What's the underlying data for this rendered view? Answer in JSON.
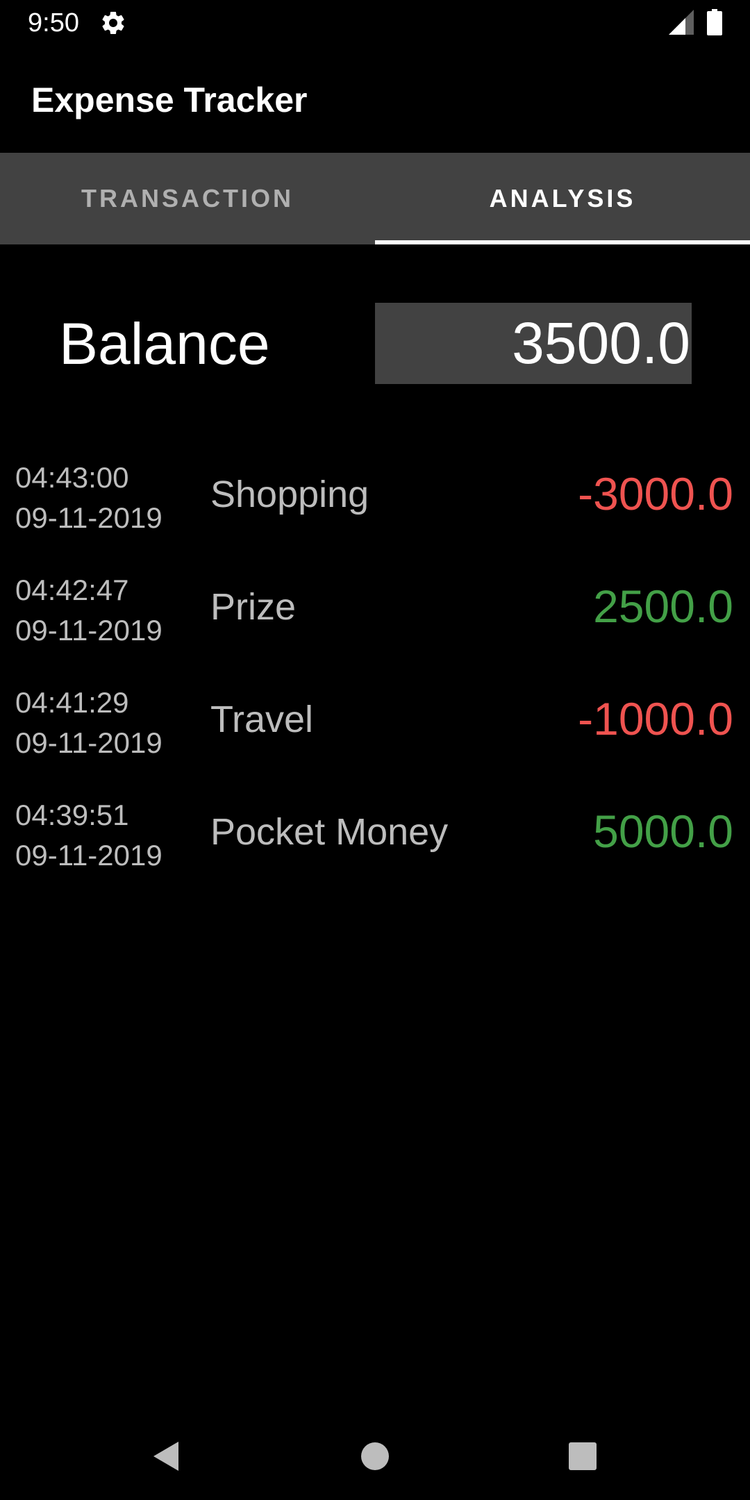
{
  "status_bar": {
    "time": "9:50",
    "icons": [
      "gear-icon",
      "signal-icon",
      "battery-icon"
    ]
  },
  "app": {
    "title": "Expense Tracker"
  },
  "tabs": [
    {
      "label": "TRANSACTION",
      "selected": false
    },
    {
      "label": "ANALYSIS",
      "selected": true
    }
  ],
  "balance": {
    "label": "Balance",
    "value": "3500.0"
  },
  "transactions": [
    {
      "time": "04:43:00",
      "date": "09-11-2019",
      "category": "Shopping",
      "amount": "-3000.0",
      "type": "expense"
    },
    {
      "time": "04:42:47",
      "date": "09-11-2019",
      "category": "Prize",
      "amount": "2500.0",
      "type": "income"
    },
    {
      "time": "04:41:29",
      "date": "09-11-2019",
      "category": "Travel",
      "amount": "-1000.0",
      "type": "expense"
    },
    {
      "time": "04:39:51",
      "date": "09-11-2019",
      "category": "Pocket Money",
      "amount": "5000.0",
      "type": "income"
    }
  ],
  "nav_bar": {
    "icons": [
      "back-icon",
      "home-icon",
      "recents-icon"
    ]
  },
  "colors": {
    "background": "#000000",
    "tab_bar": "#424242",
    "expense": "#ef5350",
    "income": "#43a047",
    "muted_text": "#bdbdbd"
  }
}
